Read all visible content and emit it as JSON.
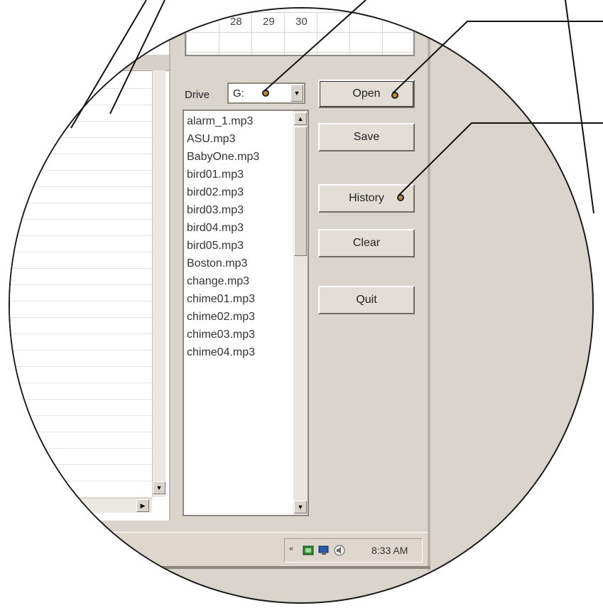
{
  "calendar": {
    "days": [
      "28",
      "29",
      "30"
    ]
  },
  "drive": {
    "label": "Drive",
    "value": "G:"
  },
  "files": [
    "alarm_1.mp3",
    "ASU.mp3",
    "BabyOne.mp3",
    "bird01.mp3",
    "bird02.mp3",
    "bird03.mp3",
    "bird04.mp3",
    "bird05.mp3",
    "Boston.mp3",
    "change.mp3",
    "chime01.mp3",
    "chime02.mp3",
    "chime03.mp3",
    "chime04.mp3"
  ],
  "buttons": {
    "open": "Open",
    "save": "Save",
    "history": "History",
    "clear": "Clear",
    "quit": "Quit"
  },
  "taskbar": {
    "time": "8:33 AM",
    "collapse_glyph": "«"
  },
  "colors": {
    "callout_dot": "#c08a3e",
    "dialog_bg": "#d9d4cc"
  },
  "icons": {
    "drive_arrow": "chevron-down-icon",
    "scroll_up": "scroll-up-icon",
    "scroll_down": "scroll-down-icon",
    "scroll_right": "scroll-right-icon",
    "tray": [
      "network-icon",
      "monitor-icon",
      "volume-icon"
    ]
  }
}
